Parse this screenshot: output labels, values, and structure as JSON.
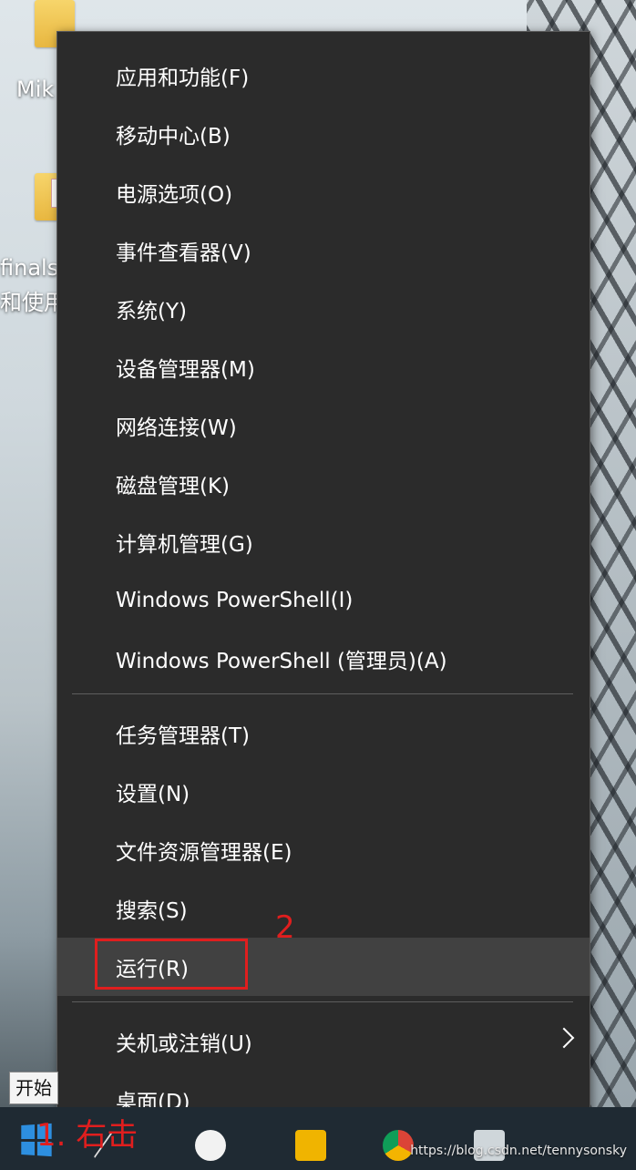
{
  "desktop": {
    "icon1_label": "Mik",
    "icon2_label_line1": "finalsh",
    "icon2_label_line2": "和使用"
  },
  "menu": {
    "items": [
      {
        "label": "应用和功能(F)"
      },
      {
        "label": "移动中心(B)"
      },
      {
        "label": "电源选项(O)"
      },
      {
        "label": "事件查看器(V)"
      },
      {
        "label": "系统(Y)"
      },
      {
        "label": "设备管理器(M)"
      },
      {
        "label": "网络连接(W)"
      },
      {
        "label": "磁盘管理(K)"
      },
      {
        "label": "计算机管理(G)"
      },
      {
        "label": "Windows PowerShell(I)"
      },
      {
        "label": "Windows PowerShell (管理员)(A)"
      },
      {
        "label": "任务管理器(T)"
      },
      {
        "label": "设置(N)"
      },
      {
        "label": "文件资源管理器(E)"
      },
      {
        "label": "搜索(S)"
      },
      {
        "label": "运行(R)"
      },
      {
        "label": "关机或注销(U)"
      },
      {
        "label": "桌面(D)"
      }
    ],
    "hovered_item": "运行(R)"
  },
  "annotations": {
    "step1": "1. 右击",
    "step2": "2",
    "highlight_color": "#e01e1e"
  },
  "taskbar": {
    "start_tooltip": "开始",
    "watermark": "https://blog.csdn.net/tennysonsky"
  },
  "icons": [
    "windows-start-icon",
    "chevron-right-icon",
    "folder-icon",
    "search-icon",
    "chrome-icon"
  ]
}
